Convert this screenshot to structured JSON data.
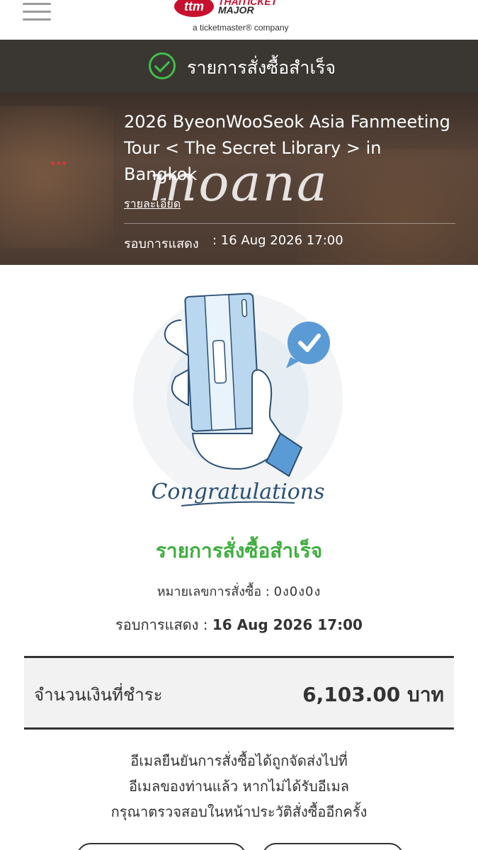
{
  "header": {
    "menu_icon": "hamburger-icon",
    "logo_mark": "ttm",
    "brand_line1": "THAITICKET",
    "brand_line2": "MAJOR",
    "tagline": "a ticketmaster® company"
  },
  "banner": {
    "icon": "check-circle-icon",
    "title": "รายการสั่งซื้อสำเร็จ",
    "accent": "#3fbf4a"
  },
  "event": {
    "title": "2026 ByeonWooSeok Asia Fanmeeting Tour < The Secret Library > in Bangkok",
    "details_link": "รายละเอียด",
    "show_label": "รอบการแสดง",
    "show_value": ": 16 Aug 2026 17:00"
  },
  "illustration": {
    "icon": "hand-holding-card-icon",
    "badge_icon": "check-badge-icon",
    "caption": "Congratulations"
  },
  "summary": {
    "title": "รายการสั่งซื้อสำเร็จ",
    "order_label": "หมายเลขการสั่งซื้อ :",
    "order_value": "0ง0ง0ง",
    "round_label": "รอบการแสดง :",
    "round_value": "16 Aug 2026 17:00",
    "amount_label": "จำนวนเงินที่ชำระ",
    "amount_value": "6,103.00 บาท"
  },
  "note": {
    "line1": "อีเมลยืนยันการสั่งซื้อได้ถูกจัดส่งไปที่",
    "line2": "อีเมลของท่านแล้ว หากไม่ได้รับอีเมล",
    "line3": "กรุณาตรวจสอบในหน้าประวัติสั่งซื้ออีกครั้ง"
  },
  "watermark": "moana"
}
